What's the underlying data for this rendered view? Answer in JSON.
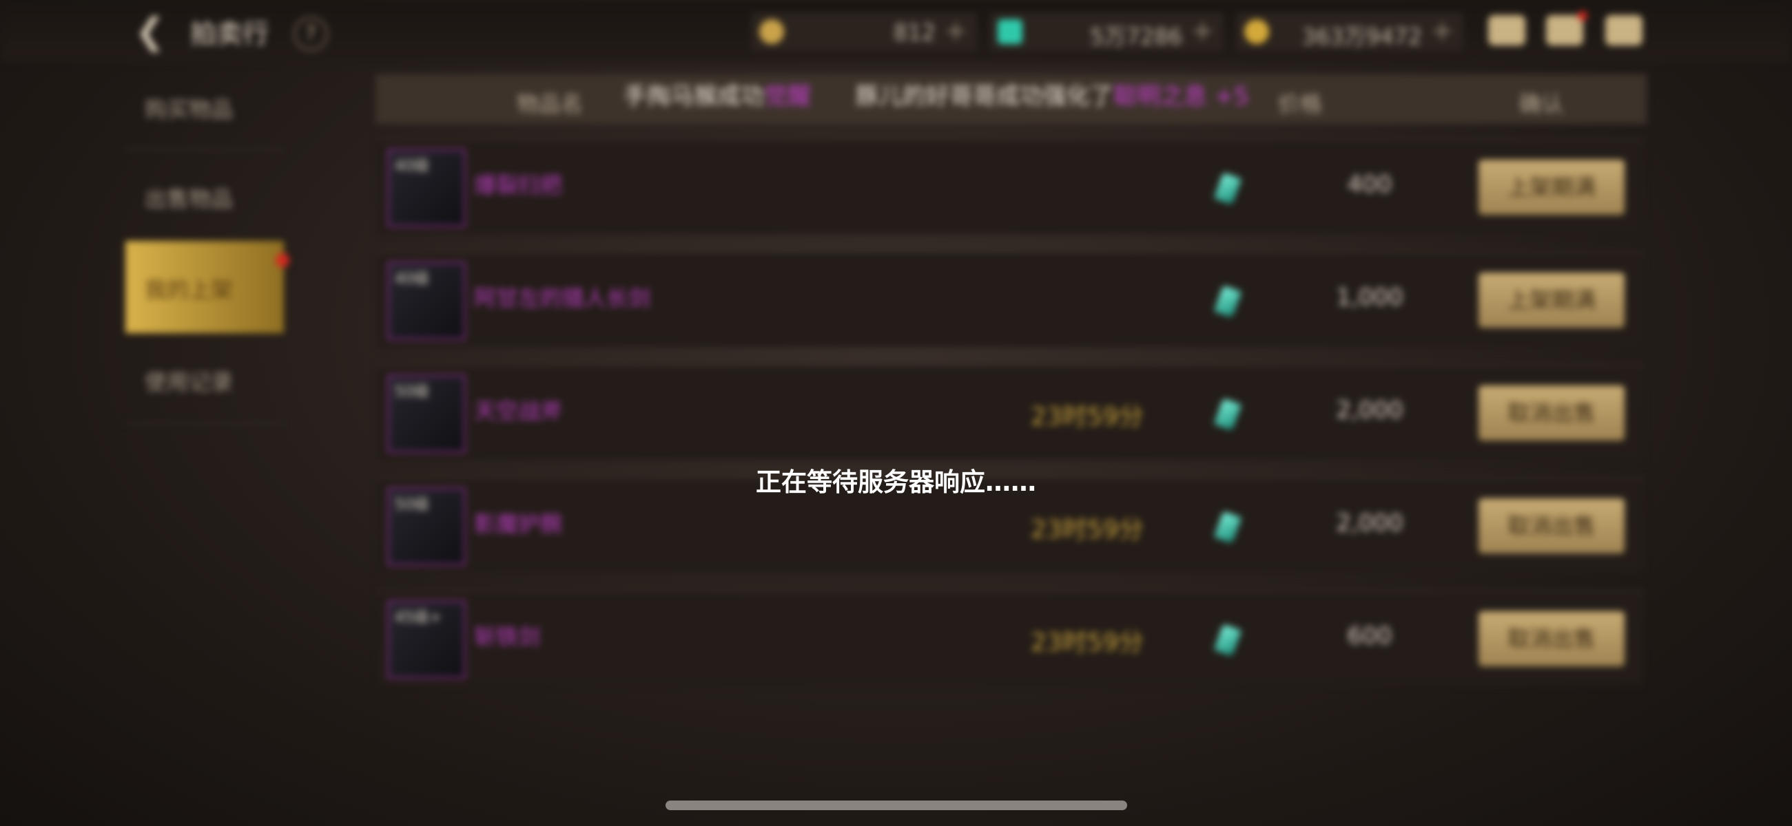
{
  "header": {
    "back_icon": "back-arrow-icon",
    "title": "拍卖行",
    "help_label": "?",
    "currencies": [
      {
        "icon": "coin-c-icon",
        "color": "#c9a24a",
        "value": "812"
      },
      {
        "icon": "gem-icon",
        "color": "#2fc9aa",
        "value": "5万7286"
      },
      {
        "icon": "gold-coin-icon",
        "color": "#d4a93a",
        "value": "363万9472"
      }
    ],
    "plus_label": "+"
  },
  "sidebar": {
    "items": [
      {
        "label": "购买物品"
      },
      {
        "label": "出售物品"
      },
      {
        "label": "我的上架",
        "active": true
      },
      {
        "label": "使用记录"
      }
    ]
  },
  "table": {
    "columns": {
      "name": "物品名",
      "price": "价格",
      "confirm": "确认"
    },
    "marquee": {
      "part1": "手掏马猴成功",
      "highlight1": "觉醒",
      "part2": "豚儿的好哥哥成功强化了",
      "highlight2": "聪明之息 +5"
    },
    "rows": [
      {
        "level": "40级",
        "name": "爆裂扫把",
        "timer": "",
        "price": "400",
        "button": "上架期满"
      },
      {
        "level": "40级",
        "name": "阿甘左的猎人长剑",
        "timer": "",
        "price": "1,000",
        "button": "上架期满"
      },
      {
        "level": "50级",
        "name": "天空战斧",
        "timer": "23时59分",
        "price": "2,000",
        "button": "取消出售"
      },
      {
        "level": "50级",
        "name": "影魔护腕",
        "timer": "23时59分",
        "price": "2,000",
        "button": "取消出售"
      },
      {
        "level": "45级+",
        "name": "斩铁剑",
        "timer": "23时59分",
        "price": "600",
        "button": "取消出售"
      }
    ]
  },
  "overlay": {
    "message": "正在等待服务器响应……"
  },
  "colors": {
    "item_name": "#b93ec1",
    "timer": "#c9a23c",
    "button_gold": "#c7aa72",
    "sidebar_active": "#d9b24a"
  }
}
